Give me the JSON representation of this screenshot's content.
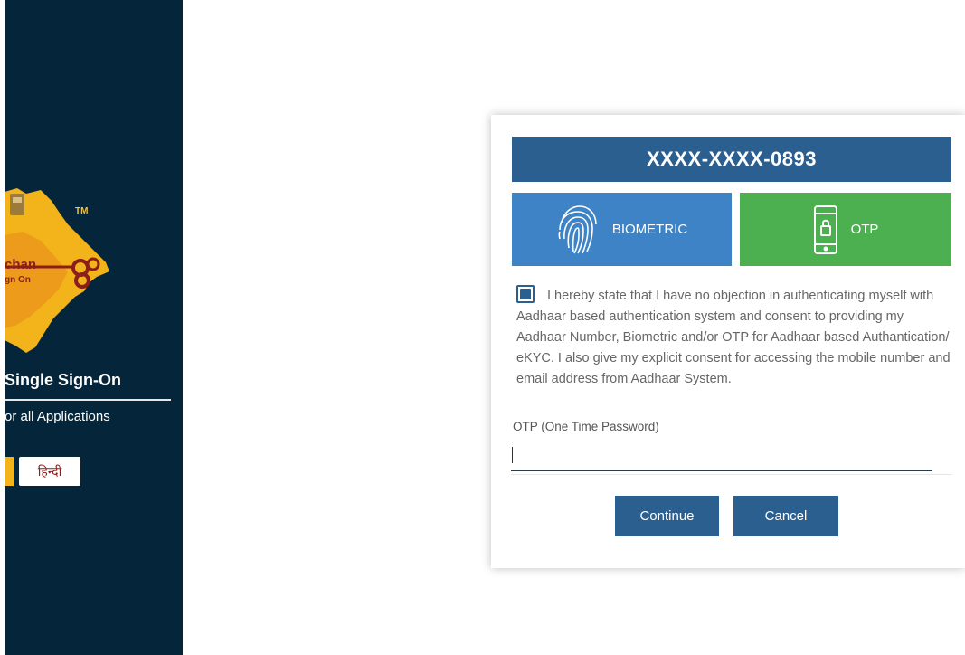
{
  "sidebar": {
    "brand_main": "chan",
    "brand_sub": "gn On",
    "trademark": "TM",
    "title": "Single Sign-On",
    "subtitle": "or all Applications",
    "language_button": "हिन्दी"
  },
  "card": {
    "masked_id": "XXXX-XXXX-0893",
    "methods": {
      "biometric_label": "BIOMETRIC",
      "otp_label": "OTP"
    },
    "consent_text": "I hereby state that I have no objection in authenticating myself with Aadhaar based authentication system and consent to providing my Aadhaar Number, Biometric and/or OTP for Aadhaar based Authantication/ eKYC. I also give my explicit consent for accessing the mobile number and email address from Aadhaar System.",
    "consent_checked": true,
    "otp_field": {
      "label": "OTP (One Time Password)",
      "value": ""
    },
    "buttons": {
      "continue": "Continue",
      "cancel": "Cancel"
    }
  },
  "colors": {
    "sidebar_bg": "#05263a",
    "banner_bg": "#2b5f8f",
    "biometric_bg": "#3d83c5",
    "otp_bg": "#4caf50",
    "button_bg": "#2b5f8f",
    "accent_yellow": "#f2b31b"
  },
  "icons": {
    "biometric": "fingerprint-icon",
    "otp": "mobile-lock-icon",
    "logo": "rajasthan-map-key-logo"
  }
}
